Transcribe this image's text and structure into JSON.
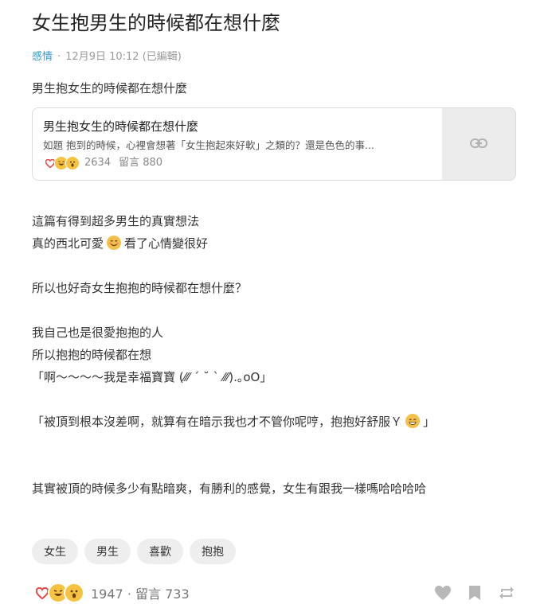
{
  "post": {
    "title": "女生抱男生的時候都在想什麼",
    "category": "感情",
    "separator": "·",
    "timestamp": "12月9日 10:12 (已編輯)",
    "intro": "男生抱女生的時候都在想什麼"
  },
  "link_card": {
    "title": "男生抱女生的時候都在想什麼",
    "description": "如題 抱到的時候，心裡會想著「女生抱起來好軟」之類的？還是色色的事...",
    "reactions_count": "2634",
    "comments": "留言 880",
    "thumb_icon": "link-icon"
  },
  "body": {
    "line1": "這篇有得到超多男生的真實想法",
    "line2_before": "真的西北可愛",
    "line2_after": "看了心情變很好",
    "line3": "所以也好奇女生抱抱的時候都在想什麼？",
    "line4": "我自己也是很愛抱抱的人",
    "line5": "所以抱抱的時候都在想",
    "line6": "「啊～～～～我是幸福寶寶 (⁄⁄⁄ ´ ˘ ` ⁄⁄⁄).｡oO」",
    "line7_before": "「被頂到根本沒差啊，就算有在暗示我也才不管你呢哼，抱抱好舒服Ｙ",
    "line7_after": "」",
    "line8": "其實被頂的時候多少有點暗爽，有勝利的感覺，女生有跟我一樣嗎哈哈哈哈"
  },
  "tags": [
    "女生",
    "男生",
    "喜歡",
    "抱抱"
  ],
  "footer": {
    "reactions_count": "1947",
    "separator": "·",
    "comments": "留言 733"
  },
  "colors": {
    "accent": "#3397cf",
    "heart": "#e64a4a",
    "emoji_yellow": "#f5c242"
  }
}
